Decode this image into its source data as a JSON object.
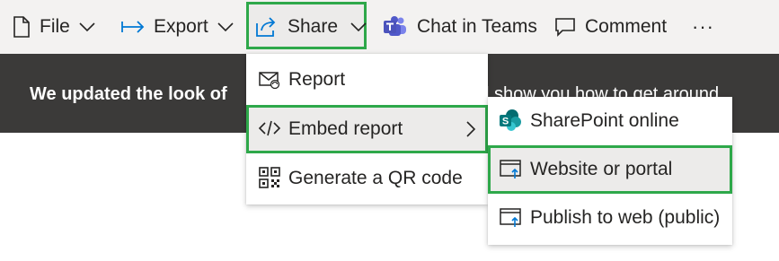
{
  "toolbar": {
    "file_label": "File",
    "export_label": "Export",
    "share_label": "Share",
    "chat_label": "Chat in Teams",
    "comment_label": "Comment",
    "more_label": "···"
  },
  "banner": {
    "text_left": "We updated the look of",
    "text_right": "l show you how to get around."
  },
  "share_menu": {
    "items": [
      {
        "label": "Report",
        "icon": "report-envelope-icon"
      },
      {
        "label": "Embed report",
        "icon": "code-icon"
      },
      {
        "label": "Generate a QR code",
        "icon": "qr-code-icon"
      }
    ]
  },
  "embed_submenu": {
    "items": [
      {
        "label": "SharePoint online",
        "icon": "sharepoint-icon"
      },
      {
        "label": "Website or portal",
        "icon": "website-icon"
      },
      {
        "label": "Publish to web (public)",
        "icon": "publish-web-icon"
      }
    ]
  },
  "colors": {
    "highlight_border": "#2ea84a",
    "banner_bg": "#3b3a39",
    "teams": "#5059c9",
    "sharepoint": "#03787c",
    "accent_blue": "#0078d4"
  }
}
